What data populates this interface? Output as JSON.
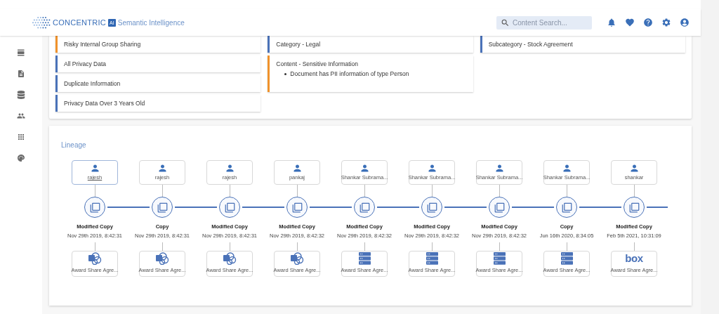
{
  "header": {
    "brand": "CONCENTRIC",
    "brand_badge": "AI",
    "product": "Semantic Intelligence",
    "search": {
      "placeholder": "Content Search..."
    }
  },
  "sidebar": {
    "items": [
      {
        "selected": false
      },
      {
        "selected": false
      },
      {
        "selected": false
      },
      {
        "selected": false
      },
      {
        "selected": false
      },
      {
        "selected": false
      }
    ]
  },
  "risk_columns": [
    {
      "cards": [
        {
          "title": "Risky Internal Group Sharing",
          "color": "#f0922b"
        },
        {
          "title": "All Privacy Data",
          "color": "#4a72b8"
        },
        {
          "title": "Duplicate Information",
          "color": "#4a72b8"
        },
        {
          "title": "Privacy Data Over 3 Years Old",
          "color": "#4a72b8"
        }
      ]
    },
    {
      "cards": [
        {
          "title": "Category - Legal",
          "color": "#4a72b8"
        },
        {
          "title": "Content - Sensitive Information",
          "color": "#f0922b",
          "bullets": [
            "Document has PII information of type Person"
          ]
        }
      ]
    },
    {
      "cards": [
        {
          "title": "Subcategory - Stock Agreement",
          "color": "#4a72b8"
        }
      ]
    }
  ],
  "lineage": {
    "title": "Lineage",
    "nodes": [
      {
        "user": "rajesh",
        "action": "Modified Copy",
        "date": "Nov 29th 2019, 8:42:31",
        "kind": "sharepoint",
        "source": "Award Share Agre...",
        "hovered": true
      },
      {
        "user": "rajesh",
        "action": "Copy",
        "date": "Nov 29th 2019, 8:42:31",
        "kind": "sharepoint",
        "source": "Award Share Agre...",
        "hovered": false
      },
      {
        "user": "rajesh",
        "action": "Modified Copy",
        "date": "Nov 29th 2019, 8:42:31",
        "kind": "sharepoint",
        "source": "Award Share Agre...",
        "hovered": false
      },
      {
        "user": "pankaj",
        "action": "Modified Copy",
        "date": "Nov 29th 2019, 8:42:32",
        "kind": "sharepoint",
        "source": "Award Share Agre...",
        "hovered": false
      },
      {
        "user": "Shankar Subrama...",
        "action": "Modified Copy",
        "date": "Nov 29th 2019, 8:42:32",
        "kind": "server",
        "source": "Award Share Agre...",
        "hovered": false
      },
      {
        "user": "Shankar Subrama...",
        "action": "Modified Copy",
        "date": "Nov 29th 2019, 8:42:32",
        "kind": "server",
        "source": "Award Share Agre...",
        "hovered": false
      },
      {
        "user": "Shankar Subrama...",
        "action": "Modified Copy",
        "date": "Nov 29th 2019, 8:42:32",
        "kind": "server",
        "source": "Award Share Agre...",
        "hovered": false
      },
      {
        "user": "Shankar Subrama...",
        "action": "Copy",
        "date": "Jun 16th 2020, 8:34:05",
        "kind": "server",
        "source": "Award Share Agre...",
        "hovered": false
      },
      {
        "user": "shankar",
        "action": "Modified Copy",
        "date": "Feb 5th 2021, 10:31:09",
        "kind": "box",
        "logo_text": "box",
        "source": "Award Share Agre...",
        "hovered": false
      }
    ]
  }
}
